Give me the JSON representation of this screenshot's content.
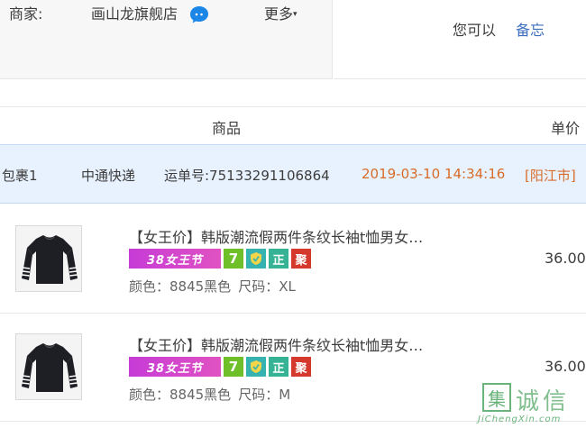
{
  "header": {
    "merchant_label": "商家:",
    "shop_name": "画山龙旗舰店",
    "more_label": "更多",
    "more_caret": "▾",
    "right_text": "您可以",
    "memo_link": "备忘"
  },
  "table": {
    "col_goods": "商品",
    "col_price": "单价"
  },
  "package": {
    "name": "包裹1",
    "courier": "中通快递",
    "waybill": "运单号:75133291106864",
    "time": "2019-03-10 14:34:16",
    "location": "[阳江市]"
  },
  "items": [
    {
      "title": "【女王价】韩版潮流假两件条纹长袖t恤男女…",
      "badges": {
        "festival": "38女王节",
        "seven": "7",
        "real": "正",
        "ju": "聚"
      },
      "color": "颜色：8845黑色",
      "size": "尺码：XL",
      "price": "36.00"
    },
    {
      "title": "【女王价】韩版潮流假两件条纹长袖t恤男女…",
      "badges": {
        "festival": "38女王节",
        "seven": "7",
        "real": "正",
        "ju": "聚"
      },
      "color": "颜色：8845黑色",
      "size": "尺码：M",
      "price": "36.00"
    }
  ],
  "watermark": {
    "mark": "集",
    "cn": "诚信",
    "en": "JiChengXin.com"
  },
  "colors": {
    "link": "#3c6fc0",
    "accent_orange": "#d76c29",
    "package_bg": "#e8f2ff",
    "festival_purple": "#c63bd6"
  }
}
